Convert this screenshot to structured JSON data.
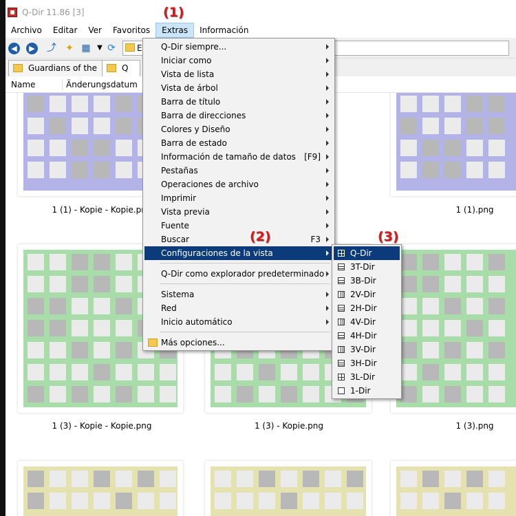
{
  "window": {
    "title": "Q-Dir 11.86 [3]"
  },
  "annotations": [
    "(1)",
    "(2)",
    "(3)"
  ],
  "menubar": [
    "Archivo",
    "Editar",
    "Ver",
    "Favoritos",
    "Extras",
    "Información"
  ],
  "toolbar": {
    "address_text": "Ex"
  },
  "tabs": [
    {
      "label": "Guardians of the ..."
    },
    {
      "label": "Q"
    }
  ],
  "columns": [
    "Name",
    "Änderungsdatum"
  ],
  "thumbnails": [
    {
      "caption": "1 (1) - Kopie - Kopie.png"
    },
    {
      "caption": "1 (1).png"
    },
    {
      "caption": "1 (3) - Kopie - Kopie.png"
    },
    {
      "caption": "1 (3) - Kopie.png"
    },
    {
      "caption": "1 (3).png"
    }
  ],
  "colors": {
    "purple": "#b3b3e8",
    "green": "#a8dca8",
    "yellow": "#e6e2b0",
    "gray_cell": "#b8b8b8",
    "light_cell": "#ebebeb"
  },
  "extras_menu": {
    "items": [
      {
        "label": "Q-Dir siempre...",
        "arrow": true
      },
      {
        "label": "Iniciar como",
        "arrow": true
      },
      {
        "label": "Vista de lista",
        "arrow": true
      },
      {
        "label": "Vista de árbol",
        "arrow": true
      },
      {
        "label": "Barra de título",
        "arrow": true
      },
      {
        "label": "Barra de direcciones",
        "arrow": true
      },
      {
        "label": "Colores y Diseño",
        "arrow": true
      },
      {
        "label": "Barra de estado",
        "arrow": true
      },
      {
        "label": "Información de tamaño de datos",
        "shortcut": "[F9]",
        "arrow": true
      },
      {
        "label": "Pestañas",
        "arrow": true
      },
      {
        "label": "Operaciones de archivo",
        "arrow": true
      },
      {
        "label": "Imprimir",
        "arrow": true
      },
      {
        "label": "Vista previa",
        "arrow": true
      },
      {
        "label": "Fuente",
        "arrow": true
      },
      {
        "label": "Buscar",
        "shortcut": "F3",
        "arrow": true
      },
      {
        "label": "Configuraciones de la vista",
        "arrow": true,
        "highlight": true
      },
      {
        "label": "Q-Dir como explorador predeterminado",
        "arrow": true
      },
      {
        "label": "Sistema",
        "arrow": true
      },
      {
        "label": "Red",
        "arrow": true
      },
      {
        "label": "Inicio automático",
        "arrow": true
      },
      {
        "label": "Más opciones..."
      }
    ]
  },
  "view_submenu": {
    "items": [
      {
        "label": "Q-Dir",
        "icon": "quad-layout-icon",
        "highlight": true
      },
      {
        "label": "3T-Dir",
        "icon": "three-top-layout-icon"
      },
      {
        "label": "3B-Dir",
        "icon": "three-bottom-layout-icon"
      },
      {
        "label": "2V-Dir",
        "icon": "two-vertical-layout-icon"
      },
      {
        "label": "2H-Dir",
        "icon": "two-horizontal-layout-icon"
      },
      {
        "label": "4V-Dir",
        "icon": "four-vertical-layout-icon"
      },
      {
        "label": "4H-Dir",
        "icon": "four-horizontal-layout-icon"
      },
      {
        "label": "3V-Dir",
        "icon": "three-vertical-layout-icon"
      },
      {
        "label": "3H-Dir",
        "icon": "three-horizontal-layout-icon"
      },
      {
        "label": "3L-Dir",
        "icon": "three-left-layout-icon"
      },
      {
        "label": "1-Dir",
        "icon": "single-layout-icon"
      }
    ]
  }
}
